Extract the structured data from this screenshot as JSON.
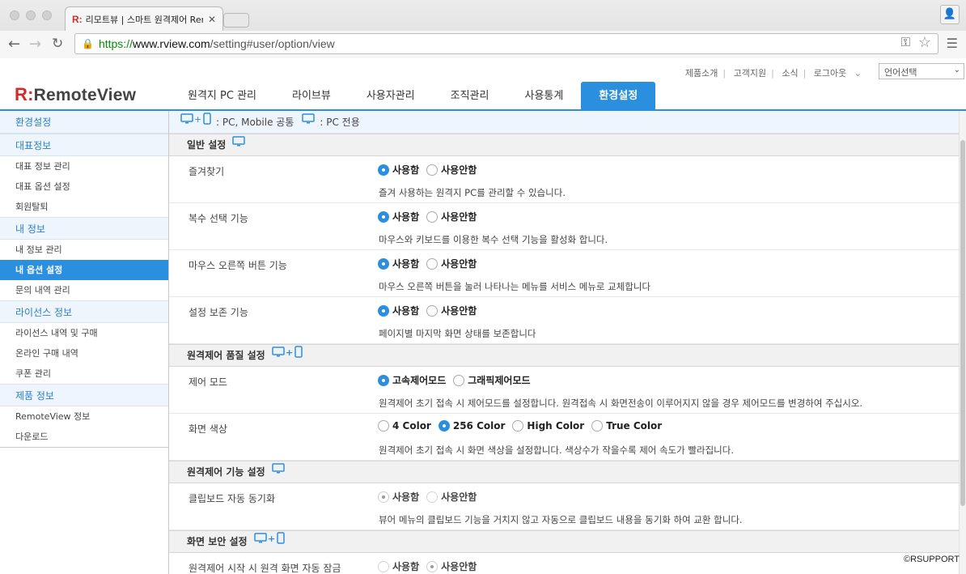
{
  "browser": {
    "tab_title": "리모트뷰 | 스마트 원격제어 Rem",
    "url_https": "https://",
    "url_host": "www.rview.com",
    "url_path": "/setting#user/option/view"
  },
  "header": {
    "top_links": [
      "제품소개",
      "고객지원",
      "소식",
      "로그아웃"
    ],
    "lang_select": "언어선택",
    "logo_mark": "R:",
    "logo_text": "RemoteView",
    "nav": [
      "원격지 PC 관리",
      "라이브뷰",
      "사용자관리",
      "조직관리",
      "사용통계",
      "환경설정"
    ],
    "active_nav": "환경설정"
  },
  "sidebar": {
    "title": "환경설정",
    "groups": [
      {
        "label": "대표정보",
        "items": [
          "대표 정보 관리",
          "대표 옵션 설정",
          "회원탈퇴"
        ]
      },
      {
        "label": "내 정보",
        "items": [
          "내 정보 관리",
          "내 옵션 설정",
          "문의 내역 관리"
        ]
      },
      {
        "label": "라이선스 정보",
        "items": [
          "라이선스 내역 및 구매",
          "온라인 구매 내역",
          "쿠폰 관리"
        ]
      },
      {
        "label": "제품 정보",
        "items": [
          "RemoteView 정보",
          "다운로드"
        ]
      }
    ],
    "active_item": "내 옵션 설정"
  },
  "legend": {
    "common": ": PC, Mobile 공통",
    "pc_only": ": PC 전용"
  },
  "sections": [
    {
      "title": "일반 설정",
      "icon": "pc",
      "rows": [
        {
          "label": "즐겨찾기",
          "options": [
            "사용함",
            "사용안함"
          ],
          "selected": 0,
          "desc": "즐겨 사용하는 원격지 PC를 관리할 수 있습니다."
        },
        {
          "label": "복수 선택 기능",
          "options": [
            "사용함",
            "사용안함"
          ],
          "selected": 0,
          "desc": "마우스와 키보드를 이용한 복수 선택 기능을 활성화 합니다."
        },
        {
          "label": "마우스 오른쪽 버튼 기능",
          "options": [
            "사용함",
            "사용안함"
          ],
          "selected": 0,
          "desc": "마우스 오른쪽 버튼을 눌러 나타나는 메뉴를 서비스 메뉴로 교체합니다"
        },
        {
          "label": "설정 보존 기능",
          "options": [
            "사용함",
            "사용안함"
          ],
          "selected": 0,
          "desc": "페이지별 마지막 화면 상태를 보존합니다"
        }
      ]
    },
    {
      "title": "원격제어 품질 설정",
      "icon": "pc-mobile",
      "rows": [
        {
          "label": "제어 모드",
          "options": [
            "고속제어모드",
            "그래픽제어모드"
          ],
          "selected": 0,
          "desc": "원격제어 초기 접속 시 제어모드를 설정합니다. 원격접속 시 화면전송이 이루어지지 않을 경우 제어모드를 변경하여 주십시오."
        },
        {
          "label": "화면 색상",
          "options": [
            "4 Color",
            "256 Color",
            "High Color",
            "True Color"
          ],
          "selected": 1,
          "desc": "원격제어 초기 접속 시 화면 색상을 설정합니다. 색상수가 작을수록 제어 속도가 빨라집니다."
        }
      ]
    },
    {
      "title": "원격제어 기능 설정",
      "icon": "pc",
      "rows": [
        {
          "label": "클립보드 자동 동기화",
          "options": [
            "사용함",
            "사용안함"
          ],
          "selected": 0,
          "disabled": true,
          "desc": "뷰어 메뉴의 클립보드 기능을 거치지 않고 자동으로 클립보드 내용을 동기화 하여 교환 합니다."
        }
      ]
    },
    {
      "title": "화면 보안 설정",
      "icon": "pc-mobile",
      "rows": [
        {
          "label": "원격제어 시작 시 원격 화면 자동 잠금",
          "options": [
            "사용함",
            "사용안함"
          ],
          "selected": 1,
          "disabled": true,
          "desc": ""
        }
      ]
    }
  ],
  "copyright": "©RSUPPORT",
  "colors": {
    "accent": "#2b8fe0",
    "brand_red": "#d62a2a"
  }
}
